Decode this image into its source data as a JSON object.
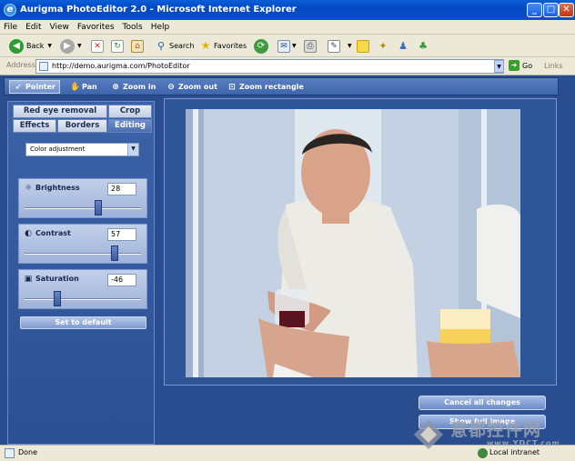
{
  "window": {
    "title": "Aurigma PhotoEditor 2.0 - Microsoft Internet Explorer",
    "minimize": "_",
    "maximize": "□",
    "close": "✕"
  },
  "menu": [
    "File",
    "Edit",
    "View",
    "Favorites",
    "Tools",
    "Help"
  ],
  "toolbar": {
    "back_label": "Back",
    "search_label": "Search",
    "favorites_label": "Favorites"
  },
  "address": {
    "label": "Address",
    "url": "http://demo.aurigma.com/PhotoEditor",
    "go_label": "Go",
    "links_label": "Links"
  },
  "editor_toolbar": {
    "pointer": "Pointer",
    "pan": "Pan",
    "zoom_in": "Zoom in",
    "zoom_out": "Zoom out",
    "zoom_rect": "Zoom rectangle",
    "active": "pointer"
  },
  "tabs": {
    "red_eye": "Red eye removal",
    "crop": "Crop",
    "effects": "Effects",
    "borders": "Borders",
    "editing": "Editing",
    "selected": "editing"
  },
  "adjust_combo": {
    "value": "Color adjustment"
  },
  "sliders": {
    "brightness": {
      "label": "Brightness",
      "value": "28",
      "level": 0.64
    },
    "contrast": {
      "label": "Contrast",
      "value": "57",
      "level": 0.79
    },
    "saturation": {
      "label": "Saturation",
      "value": "-46",
      "level": 0.27
    }
  },
  "set_default_label": "Set to default",
  "actions": {
    "cancel_all": "Cancel all changes",
    "show_full": "Show full image"
  },
  "status": {
    "text": "Done",
    "zone": "Local intranet"
  },
  "watermark": {
    "chinese": "意都控件网",
    "url": "www.YDCT.com"
  },
  "colors": {
    "title_blue": "#0347c2",
    "panel_blue": "#2a4d8f",
    "tab_selected": "#4b6db0"
  }
}
